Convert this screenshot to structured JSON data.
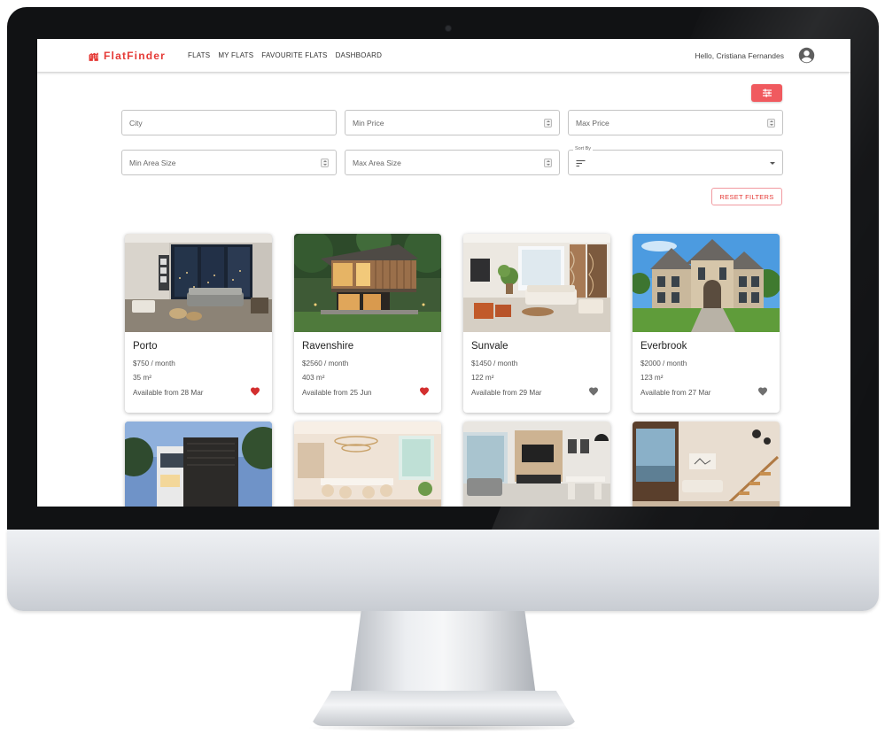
{
  "brand": {
    "name": "FlatFinder",
    "color": "#e53935",
    "icon": "building-icon"
  },
  "nav": {
    "items": [
      "FLATS",
      "MY FLATS",
      "FAVOURITE FLATS",
      "DASHBOARD"
    ]
  },
  "user": {
    "greeting": "Hello, Cristiana Fernandes",
    "icon": "account-circle-icon"
  },
  "filters": {
    "toggle_icon": "tune-icon",
    "toggle_color": "#f05a5f",
    "city_placeholder": "City",
    "min_price_placeholder": "Min Price",
    "max_price_placeholder": "Max Price",
    "min_area_placeholder": "Min Area Size",
    "max_area_placeholder": "Max Area Size",
    "sort_label": "Sort By",
    "sort_value": "",
    "reset_label": "RESET FILTERS"
  },
  "flats": [
    {
      "city": "Porto",
      "price": "$750 / month",
      "area": "35 m²",
      "available": "Available from 28 Mar",
      "favourite": true
    },
    {
      "city": "Ravenshire",
      "price": "$2560 / month",
      "area": "403 m²",
      "available": "Available from 25 Jun",
      "favourite": true
    },
    {
      "city": "Sunvale",
      "price": "$1450 / month",
      "area": "122 m²",
      "available": "Available from 29 Mar",
      "favourite": false
    },
    {
      "city": "Everbrook",
      "price": "$2000 / month",
      "area": "123 m²",
      "available": "Available from 27 Mar",
      "favourite": false
    },
    {
      "city": "",
      "price": "",
      "area": "",
      "available": "",
      "favourite": false
    },
    {
      "city": "",
      "price": "",
      "area": "",
      "available": "",
      "favourite": false
    },
    {
      "city": "",
      "price": "",
      "area": "",
      "available": "",
      "favourite": false
    },
    {
      "city": "",
      "price": "",
      "area": "",
      "available": "",
      "favourite": false
    }
  ],
  "colors": {
    "favourite_on": "#d32f2f",
    "favourite_off": "#707070"
  }
}
